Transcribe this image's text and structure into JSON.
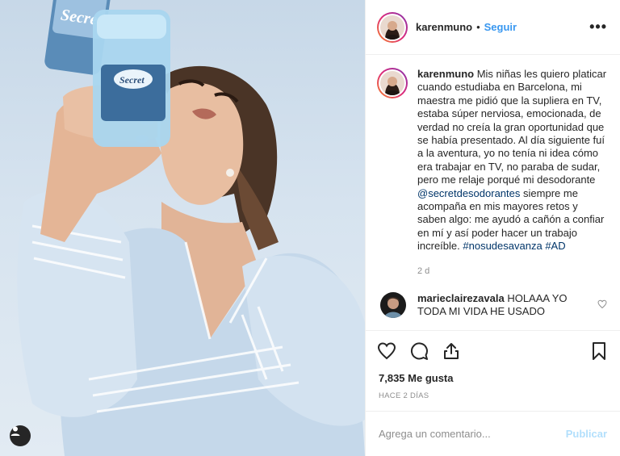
{
  "post": {
    "username": "karenmuno",
    "separator": "•",
    "follow_label": "Seguir",
    "more_label": "•••",
    "caption": {
      "username": "karenmuno",
      "text_before_mention": "Mis niñas les quiero platicar cuando estudiaba en Barcelona, mi maestra me pidió que la supliera en TV, estaba súper nerviosa, emocionada, de verdad no creía la gran oportunidad que se había presentado. Al día siguiente fuí a la aventura, yo no tenía ni idea cómo era trabajar en TV, no paraba de sudar, pero me relaje porqué mi desodorante",
      "mention": "@secretdesodorantes",
      "text_after_mention": "siempre me acompaña en mis mayores retos y saben algo: me ayudó a cañón a confiar en mí y así poder hacer un trabajo increíble.",
      "hashtag_1": "#nosudesavanza",
      "hashtag_2": "#AD",
      "age": "2 d"
    },
    "comment": {
      "username": "marieclairezavala",
      "text": "HOLAAA YO TODA MI VIDA HE USADO"
    },
    "likes": "7,835 Me gusta",
    "date": "HACE 2 DÍAS",
    "add_comment": {
      "placeholder": "Agrega un comentario...",
      "post_label": "Publicar"
    }
  },
  "photo": {
    "product_brand": "Secret"
  },
  "icons": {
    "like": "heart-icon",
    "comment": "comment-icon",
    "share": "share-icon",
    "save": "bookmark-icon",
    "tag": "user-tag-icon",
    "comment_like": "heart-small-icon"
  },
  "colors": {
    "link": "#3897f0",
    "mention": "#003569",
    "muted": "#8e8e8e",
    "post_disabled": "#b2dffc",
    "text": "#262626"
  }
}
